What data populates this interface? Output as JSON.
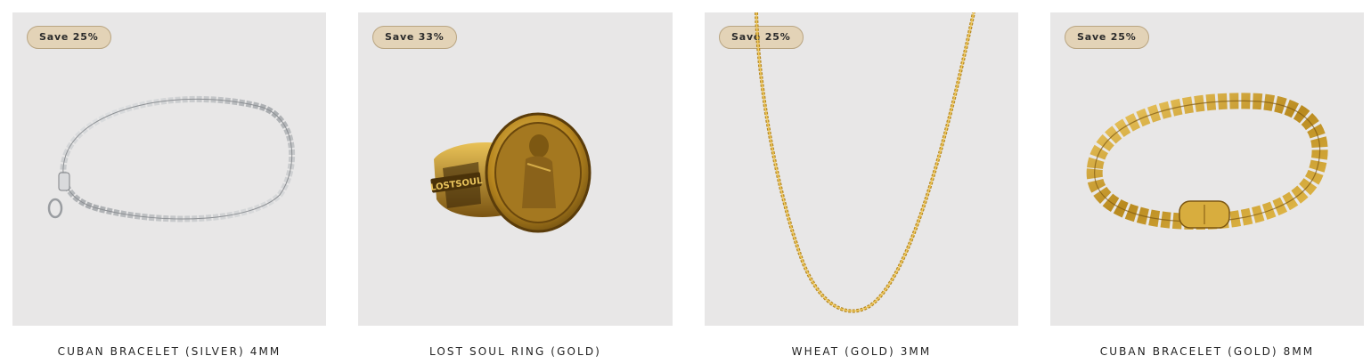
{
  "products": [
    {
      "badge": "Save 25%",
      "title": "CUBAN BRACELET (SILVER) 4MM",
      "image_icon": "silver-chain-bracelet-icon"
    },
    {
      "badge": "Save 33%",
      "title": "LOST SOUL RING (GOLD)",
      "image_icon": "gold-signet-ring-icon",
      "engraving": "LOSTSOUL"
    },
    {
      "badge": "Save 25%",
      "title": "WHEAT (GOLD) 3MM",
      "image_icon": "gold-chain-necklace-icon"
    },
    {
      "badge": "Save 25%",
      "title": "CUBAN BRACELET (GOLD) 8MM",
      "image_icon": "gold-cuban-bracelet-icon"
    }
  ],
  "colors": {
    "tile_bg": "#e8e7e7",
    "badge_bg": "#e3d3b7",
    "silver": "#c9cbcd",
    "gold": "#c9a13a"
  }
}
